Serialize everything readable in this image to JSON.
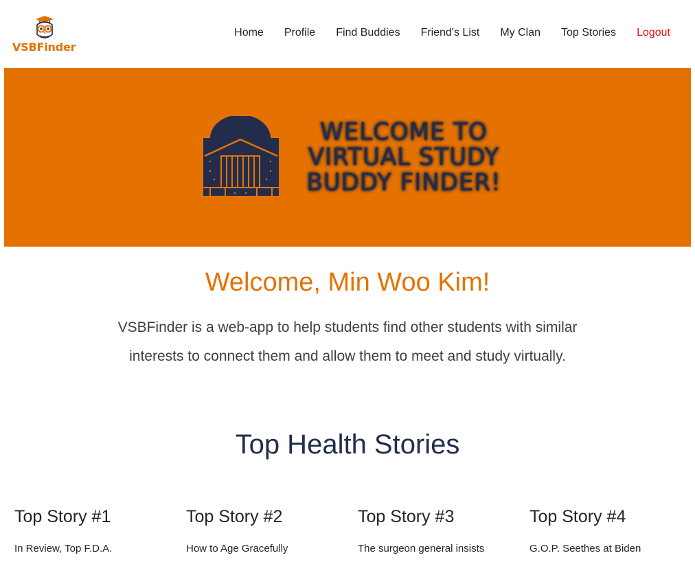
{
  "nav": {
    "brand": "VSBFinder",
    "brand_logo": "owl-logo-icon",
    "links": [
      "Home",
      "Profile",
      "Find Buddies",
      "Friend's List",
      "My Clan",
      "Top Stories",
      "Logout"
    ]
  },
  "hero": {
    "title": "Welcome to Virtual Study Buddy Finder!",
    "image": "rotunda-icon",
    "background": "#e57200"
  },
  "welcome": "Welcome, Min Woo Kim!",
  "intro": "VSBFinder is a web-app to help students find other students with similar interests to connect them and allow them to meet and study virtually.",
  "section_title": "Top Health Stories",
  "stories": [
    {
      "title": "Top Story #1",
      "snippet": "In Review, Top F.D.A."
    },
    {
      "title": "Top Story #2",
      "snippet": "How to Age Gracefully"
    },
    {
      "title": "Top Story #3",
      "snippet": "The surgeon general insists"
    },
    {
      "title": "Top Story #4",
      "snippet": "G.O.P. Seethes at Biden"
    }
  ],
  "colors": {
    "accent": "#e57200",
    "navy": "#232d4b",
    "logout": "#e51010"
  }
}
